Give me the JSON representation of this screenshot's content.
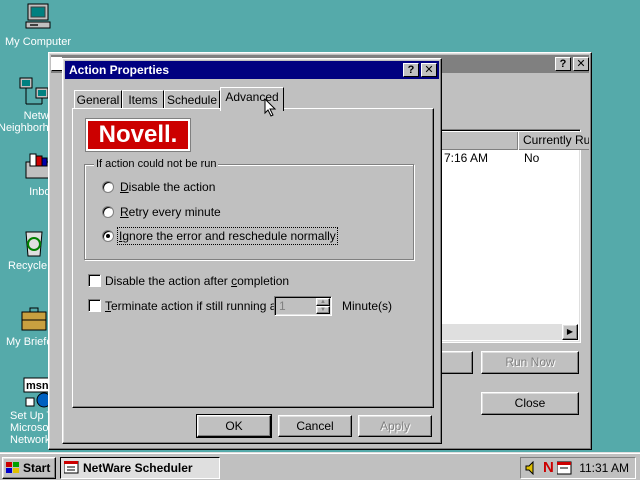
{
  "desktop_icons": [
    {
      "label": "My Computer",
      "icon": "my-computer-icon"
    },
    {
      "label": "Network Neighborhood",
      "icon": "network-neighborhood-icon"
    },
    {
      "label": "Inbox",
      "icon": "inbox-icon"
    },
    {
      "label": "Recycle Bin",
      "icon": "recycle-bin-icon"
    },
    {
      "label": "My Briefcase",
      "icon": "briefcase-icon"
    },
    {
      "label": "Set Up The Microsoft Network",
      "icon": "msn-icon"
    }
  ],
  "desktop_labels": {
    "my_computer": "My Computer",
    "network_line1": "Network",
    "network_line2": "Neighborhood",
    "inbox": "Inbox",
    "recycle": "Recycle Bin",
    "briefcase": "My Briefcase",
    "msn_line1": "Set Up The",
    "msn_line2": "Microsoft",
    "msn_line3": "Network"
  },
  "background_window": {
    "column_header": "Currently Running",
    "row_time": "7:16 AM",
    "row_running": "No",
    "run_now_label": "Run Now",
    "close_label": "Close",
    "help_glyph": "?",
    "close_glyph": "✕"
  },
  "dialog": {
    "title": "Action Properties",
    "help_glyph": "?",
    "close_glyph": "✕",
    "tabs": [
      {
        "label": "General"
      },
      {
        "label": "Items"
      },
      {
        "label": "Schedule"
      },
      {
        "label": "Advanced",
        "selected": true
      }
    ],
    "logo_text": "Novell.",
    "group_label": "If action could not be run",
    "radio_options": [
      {
        "label_pre": "",
        "label_ul": "D",
        "label_post": "isable the action",
        "checked": false
      },
      {
        "label_pre": "",
        "label_ul": "R",
        "label_post": "etry every minute",
        "checked": false
      },
      {
        "label_pre": "",
        "label_ul": "I",
        "label_post": "gnore the error and reschedule normally",
        "checked": true
      }
    ],
    "check_disable": {
      "label_pre": "Disable the action after ",
      "label_ul": "c",
      "label_post": "ompletion",
      "checked": false
    },
    "check_terminate": {
      "label_pre": "",
      "label_ul": "T",
      "label_post": "erminate action if still running after",
      "checked": false
    },
    "minutes_value": "1",
    "minutes_unit": "Minute(s)",
    "ok_label": "OK",
    "cancel_label": "Cancel",
    "apply_label": "Apply"
  },
  "taskbar": {
    "start_label": "Start",
    "task_label": "NetWare Scheduler",
    "clock": "11:31 AM",
    "tray_novell_glyph": "N",
    "colors": {
      "title_active": "#000080",
      "desktop": "#55aaaa",
      "face": "#c0c0c0",
      "novell_red": "#cc0000"
    }
  }
}
